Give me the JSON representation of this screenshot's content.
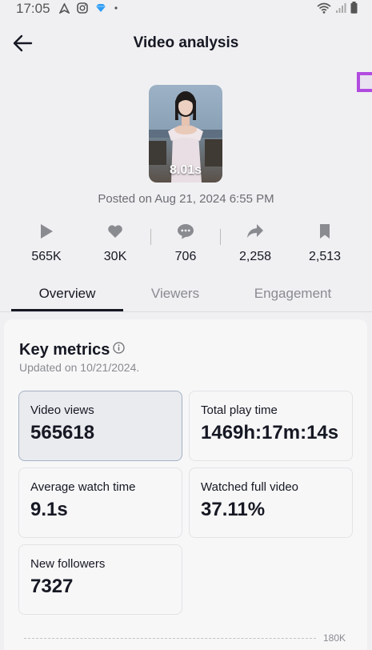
{
  "status_bar": {
    "time": "17:05",
    "left_icons": [
      "navigation-icon",
      "instagram-icon",
      "diamond-icon",
      "dot-icon"
    ],
    "right_icons": [
      "wifi-icon",
      "signal-icon",
      "battery-icon"
    ]
  },
  "nav": {
    "title": "Video analysis"
  },
  "video": {
    "duration": "8.01s",
    "posted": "Posted on Aug 21, 2024 6:55 PM"
  },
  "stats": {
    "plays": "565K",
    "likes": "30K",
    "comments": "706",
    "shares": "2,258",
    "saves": "2,513"
  },
  "tabs": [
    "Overview",
    "Viewers",
    "Engagement"
  ],
  "key_metrics": {
    "title": "Key metrics",
    "updated": "Updated on 10/21/2024.",
    "items": [
      {
        "label": "Video views",
        "value": "565618"
      },
      {
        "label": "Total play time",
        "value": "1469h:17m:14s"
      },
      {
        "label": "Average watch time",
        "value": "9.1s"
      },
      {
        "label": "Watched full video",
        "value": "37.11%"
      },
      {
        "label": "New followers",
        "value": "7327"
      }
    ]
  },
  "chart": {
    "axis_max_label": "180K"
  },
  "colors": {
    "accent_marker": "#b14be0",
    "text_primary": "#161823",
    "text_secondary": "#8a8b91"
  }
}
